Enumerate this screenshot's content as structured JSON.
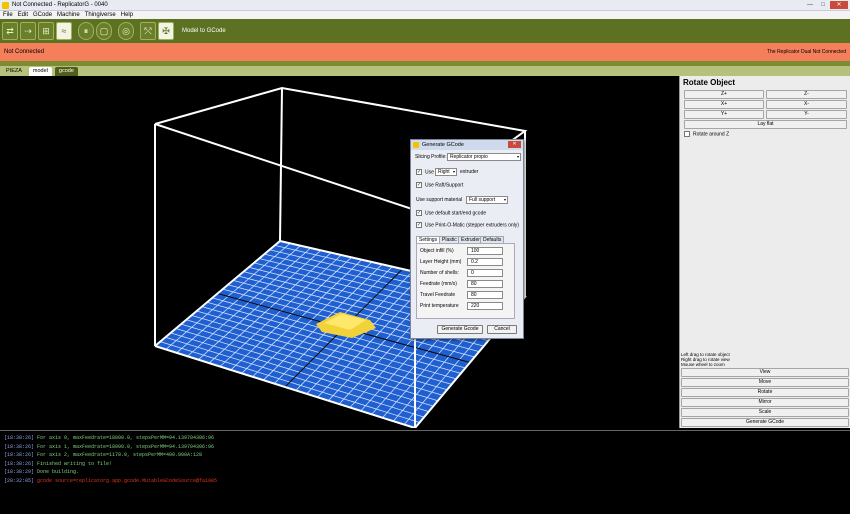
{
  "window": {
    "title": "Not Connected - ReplicatorG - 0040",
    "controls": [
      "—",
      "□",
      "✕"
    ]
  },
  "menu": [
    "File",
    "Edit",
    "GCode",
    "Machine",
    "Thingiverse",
    "Help"
  ],
  "toolbar": {
    "model_to_gcode_label": "Model to GCode"
  },
  "status": {
    "left": "Not Connected",
    "right": "The Replicator Dual Not Connected"
  },
  "tabs": [
    "PIEZA",
    "model",
    "gcode"
  ],
  "right_panel": {
    "title": "Rotate Object",
    "rot_buttons": [
      "Z+",
      "Z-",
      "X+",
      "X-",
      "Y+",
      "Y-"
    ],
    "lay_flat": "Lay flat",
    "rotate_around_z": "Rotate around Z",
    "hints": [
      "Left drag to rotate object",
      "Right drag to rotate view",
      "Mouse wheel to zoom"
    ],
    "mode_buttons": [
      "View",
      "Move",
      "Rotate",
      "Mirror",
      "Scale",
      "Generate GCode"
    ]
  },
  "dialog": {
    "title": "Generate GCode",
    "slicing_profile_label": "Slicing Profile:",
    "slicing_profile_value": "Replicator propio",
    "use_label": "Use",
    "extruder_value": "Right",
    "extruder_label": "extruder",
    "use_raft": "Use Raft/Support",
    "support_label": "Use support material",
    "support_value": "Full support",
    "use_default_gcode": "Use default start/end gcode",
    "use_printomatic": "Use Print-O-Matic (stepper extruders only)",
    "tabs": [
      "Settings",
      "Plastic",
      "Extruder",
      "Defaults"
    ],
    "fields": [
      {
        "label": "Object infill (%)",
        "value": "100"
      },
      {
        "label": "Layer Height (mm)",
        "value": "0.2"
      },
      {
        "label": "Number of shells:",
        "value": "0"
      },
      {
        "label": "Feedrate (mm/s)",
        "value": "80"
      },
      {
        "label": "Travel Feedrate",
        "value": "80"
      },
      {
        "label": "Print temperature",
        "value": "220"
      }
    ],
    "generate_button": "Generate Gcode",
    "cancel_button": "Cancel"
  },
  "console": [
    {
      "ts": "[18:38:26]",
      "text": "For axis 0, maxFeedrate=18000.0, stepsPerMM=94.139704306:96",
      "color": "#7fd07f"
    },
    {
      "ts": "[18:38:26]",
      "text": "For axis 1, maxFeedrate=18000.0, stepsPerMM=94.139704306:96",
      "color": "#7fd07f"
    },
    {
      "ts": "[18:38:26]",
      "text": "For axis 2, maxFeedrate=1170.0, stepsPerMM=400.000A:128",
      "color": "#7fd07f"
    },
    {
      "ts": "[18:38:26]",
      "text": "Finished writing to file!",
      "color": "#7fd07f"
    },
    {
      "ts": "[18:38:29]",
      "text": "Done building.",
      "color": "#7fd07f"
    },
    {
      "ts": "[20:32:05]",
      "text": "gcode source=replicatorg.app.gcode.MutableGCodeSource@fa1905",
      "color": "#e0341e"
    }
  ],
  "colors": {
    "toolbar": "#5d7122",
    "status": "#f47f5a",
    "grid": "#1f5fd0",
    "object": "#f2d23a",
    "console_ts": "#8ea0e8"
  }
}
